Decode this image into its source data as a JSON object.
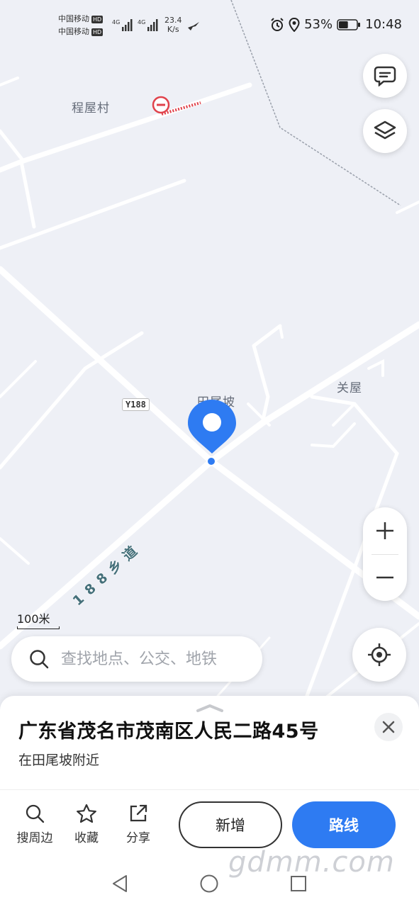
{
  "status_bar": {
    "carrier_1": "中国移动",
    "carrier_2": "中国移动",
    "hd": "HD",
    "net_1": "4G",
    "net_2": "4G",
    "speed_value": "23.4",
    "speed_unit": "K/s",
    "battery_percent": "53%",
    "battery_level": 0.53,
    "time": "10:48"
  },
  "map": {
    "places": [
      "程屋村",
      "田尾坡",
      "关屋"
    ],
    "road_badge": "Y188",
    "road_name": "188乡道",
    "scale_label": "100米"
  },
  "search": {
    "placeholder": "查找地点、公交、地铁"
  },
  "sheet": {
    "address": "广东省茂名市茂南区人民二路45号",
    "subtitle": "在田尾坡附近",
    "actions": {
      "nearby": "搜周边",
      "favorite": "收藏",
      "share": "分享"
    },
    "add_label": "新增",
    "route_label": "路线"
  },
  "watermark": "gdmm.com",
  "colors": {
    "accent": "#2e7bf2",
    "map_bg": "#eef0f6",
    "road": "#ffffff",
    "no_entry": "#e0424b"
  },
  "icons": [
    "feedback-icon",
    "layers-icon",
    "locate-icon",
    "search-icon",
    "star-icon",
    "share-icon",
    "close-icon",
    "no-entry-icon",
    "location-pin-icon"
  ]
}
